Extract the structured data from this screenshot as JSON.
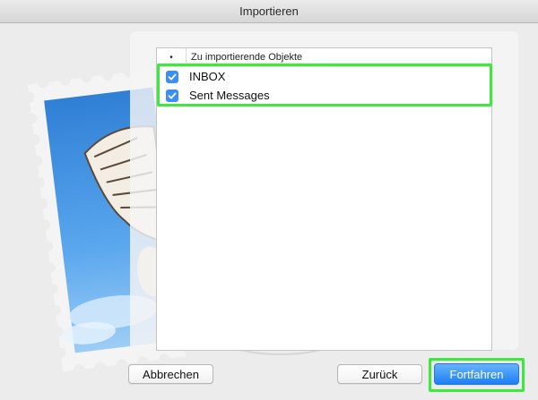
{
  "window": {
    "title": "Importieren"
  },
  "list": {
    "header_marker": "•",
    "header_label": "Zu importierende Objekte",
    "items": [
      {
        "label": "INBOX",
        "checked": true
      },
      {
        "label": "Sent Messages",
        "checked": true
      }
    ]
  },
  "buttons": {
    "cancel_label": "Abbrechen",
    "back_label": "Zurück",
    "continue_label": "Fortfahren"
  },
  "colors": {
    "accent": "#3a8ef6",
    "highlight": "#3ee83e"
  }
}
